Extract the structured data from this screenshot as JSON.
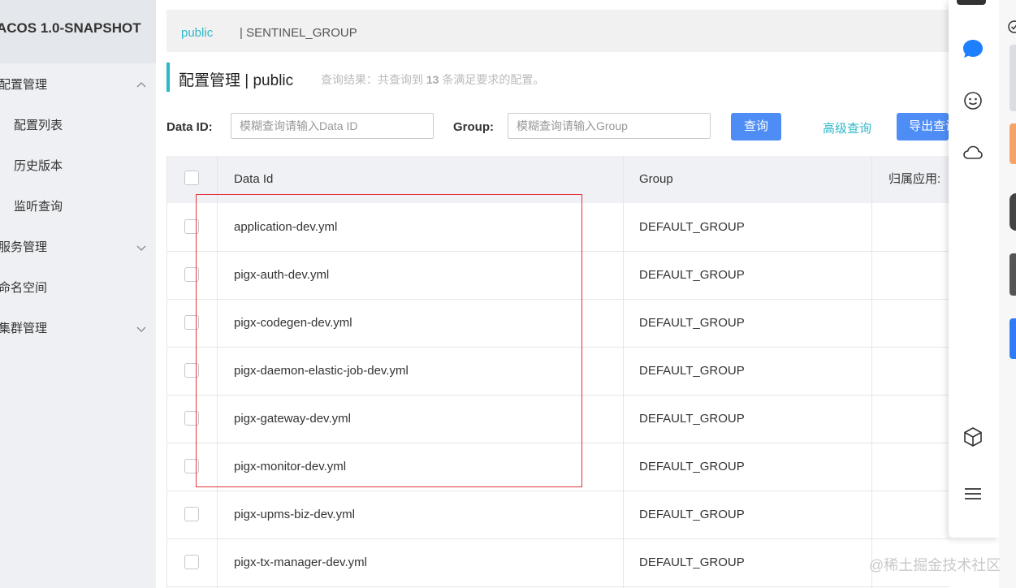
{
  "brand": "ACOS 1.0-SNAPSHOT",
  "sidebar": {
    "items": [
      {
        "label": "配置管理",
        "expanded": true
      },
      {
        "label": "配置列表"
      },
      {
        "label": "历史版本"
      },
      {
        "label": "监听查询"
      },
      {
        "label": "服务管理",
        "expanded": false
      },
      {
        "label": "命名空间"
      },
      {
        "label": "集群管理",
        "expanded": false
      }
    ]
  },
  "breadcrumb": {
    "namespace": "public",
    "group": "| SENTINEL_GROUP"
  },
  "header": {
    "title": "配置管理 | public",
    "result_prefix": "查询结果：共查询到",
    "result_count": "13",
    "result_suffix": "条满足要求的配置。"
  },
  "search": {
    "data_id_label": "Data ID:",
    "data_id_placeholder": "模糊查询请输入Data ID",
    "group_label": "Group:",
    "group_placeholder": "模糊查询请输入Group",
    "query_button": "查询",
    "advanced_link": "高级查询",
    "export_button": "导出查询"
  },
  "table": {
    "columns": [
      "Data Id",
      "Group",
      "归属应用:"
    ],
    "rows": [
      {
        "data_id": "application-dev.yml",
        "group": "DEFAULT_GROUP"
      },
      {
        "data_id": "pigx-auth-dev.yml",
        "group": "DEFAULT_GROUP"
      },
      {
        "data_id": "pigx-codegen-dev.yml",
        "group": "DEFAULT_GROUP"
      },
      {
        "data_id": "pigx-daemon-elastic-job-dev.yml",
        "group": "DEFAULT_GROUP"
      },
      {
        "data_id": "pigx-gateway-dev.yml",
        "group": "DEFAULT_GROUP"
      },
      {
        "data_id": "pigx-monitor-dev.yml",
        "group": "DEFAULT_GROUP"
      },
      {
        "data_id": "pigx-upms-biz-dev.yml",
        "group": "DEFAULT_GROUP"
      },
      {
        "data_id": "pigx-tx-manager-dev.yml",
        "group": "DEFAULT_GROUP"
      }
    ]
  },
  "toolbar_icons": [
    "check-circle-icon",
    "chat-bubble-icon",
    "face-icon",
    "cloud-icon",
    "cube-icon",
    "menu-icon"
  ],
  "colors": {
    "accent": "#2fb7c9",
    "primary_button": "#4d8df5",
    "highlight_box": "#e3323b"
  },
  "watermark": "@稀土掘金技术社区"
}
